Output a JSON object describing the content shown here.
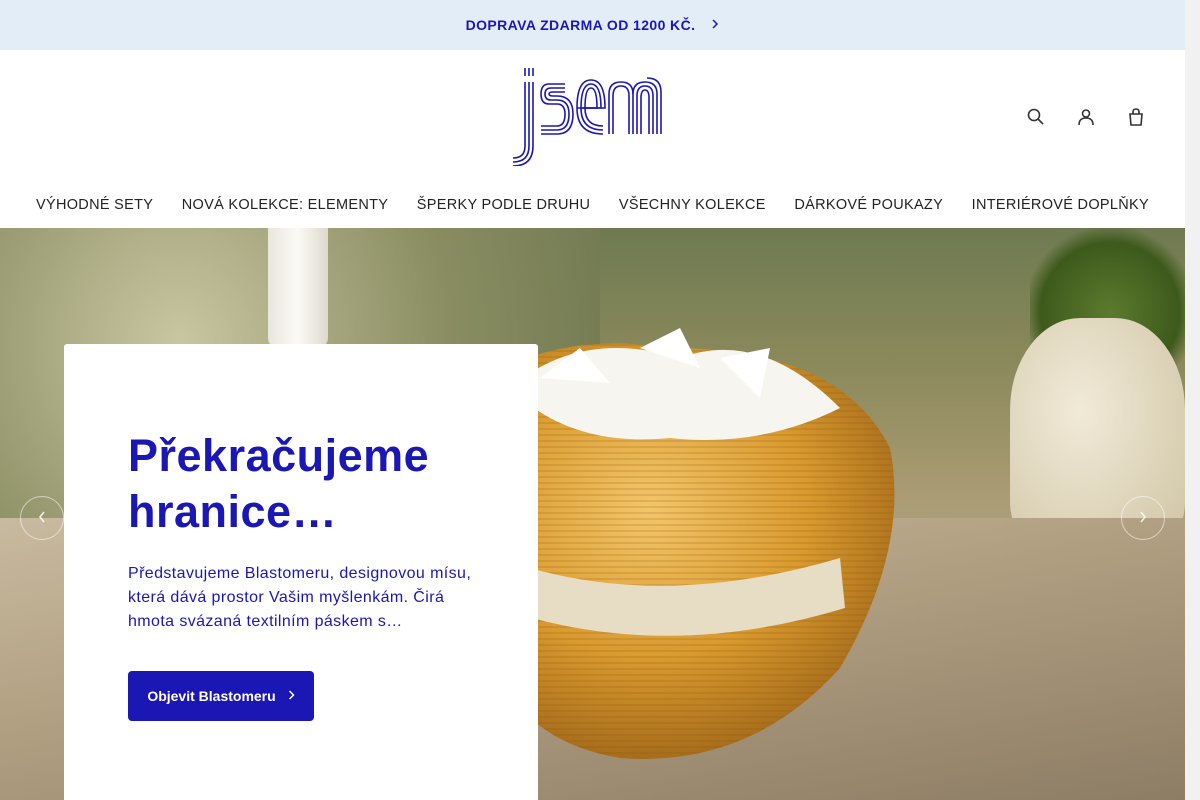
{
  "announcement": {
    "text": "DOPRAVA ZDARMA OD 1200 KČ.",
    "icon": "chevron-right-icon"
  },
  "header": {
    "logo_text": "jsem",
    "icons": [
      "search-icon",
      "account-icon",
      "cart-icon"
    ]
  },
  "nav": {
    "items": [
      "VÝHODNÉ SETY",
      "NOVÁ KOLEKCE: ELEMENTY",
      "ŠPERKY PODLE DRUHU",
      "VŠECHNY KOLEKCE",
      "DÁRKOVÉ POUKAZY",
      "INTERIÉROVÉ DOPLŇKY"
    ]
  },
  "hero": {
    "title": "Překračujeme hranice…",
    "description": "Představujeme Blastomeru, designovou mísu, která dává prostor Vašim myšlenkám. Čirá hmota svázaná textilním páskem s…",
    "button_label": "Objevit Blastomeru",
    "prev_icon": "chevron-left-icon",
    "next_icon": "chevron-right-icon"
  },
  "colors": {
    "brand": "#1b17b5",
    "announce_bg": "#e3edf8"
  }
}
